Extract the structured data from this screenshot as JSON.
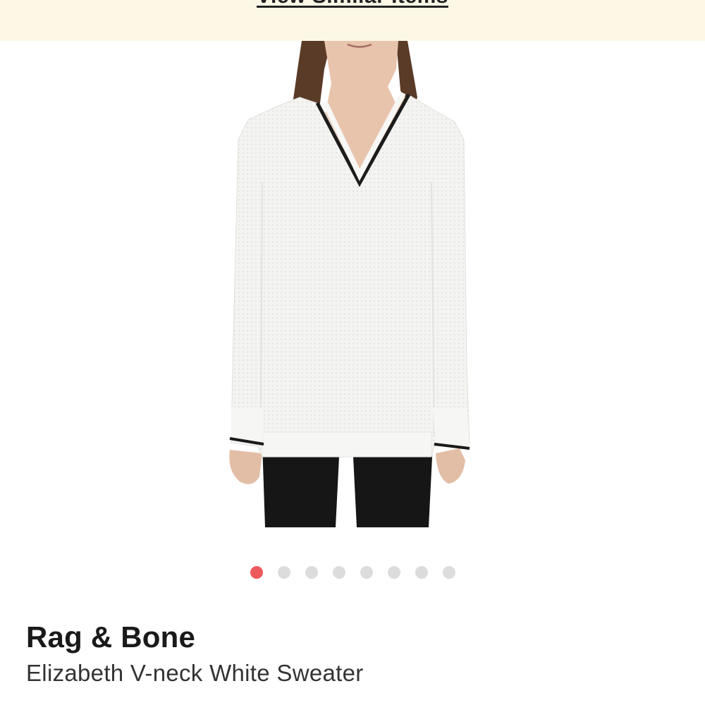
{
  "banner": {
    "link_label": "View Similar Items"
  },
  "product": {
    "brand": "Rag & Bone",
    "name": "Elizabeth V-neck White Sweater"
  },
  "carousel": {
    "total_images": 8,
    "active_index": 0
  },
  "colors": {
    "banner_bg": "#fdf8e6",
    "dot_active": "#ee5a5c",
    "dot_inactive": "#dcdcdc"
  }
}
